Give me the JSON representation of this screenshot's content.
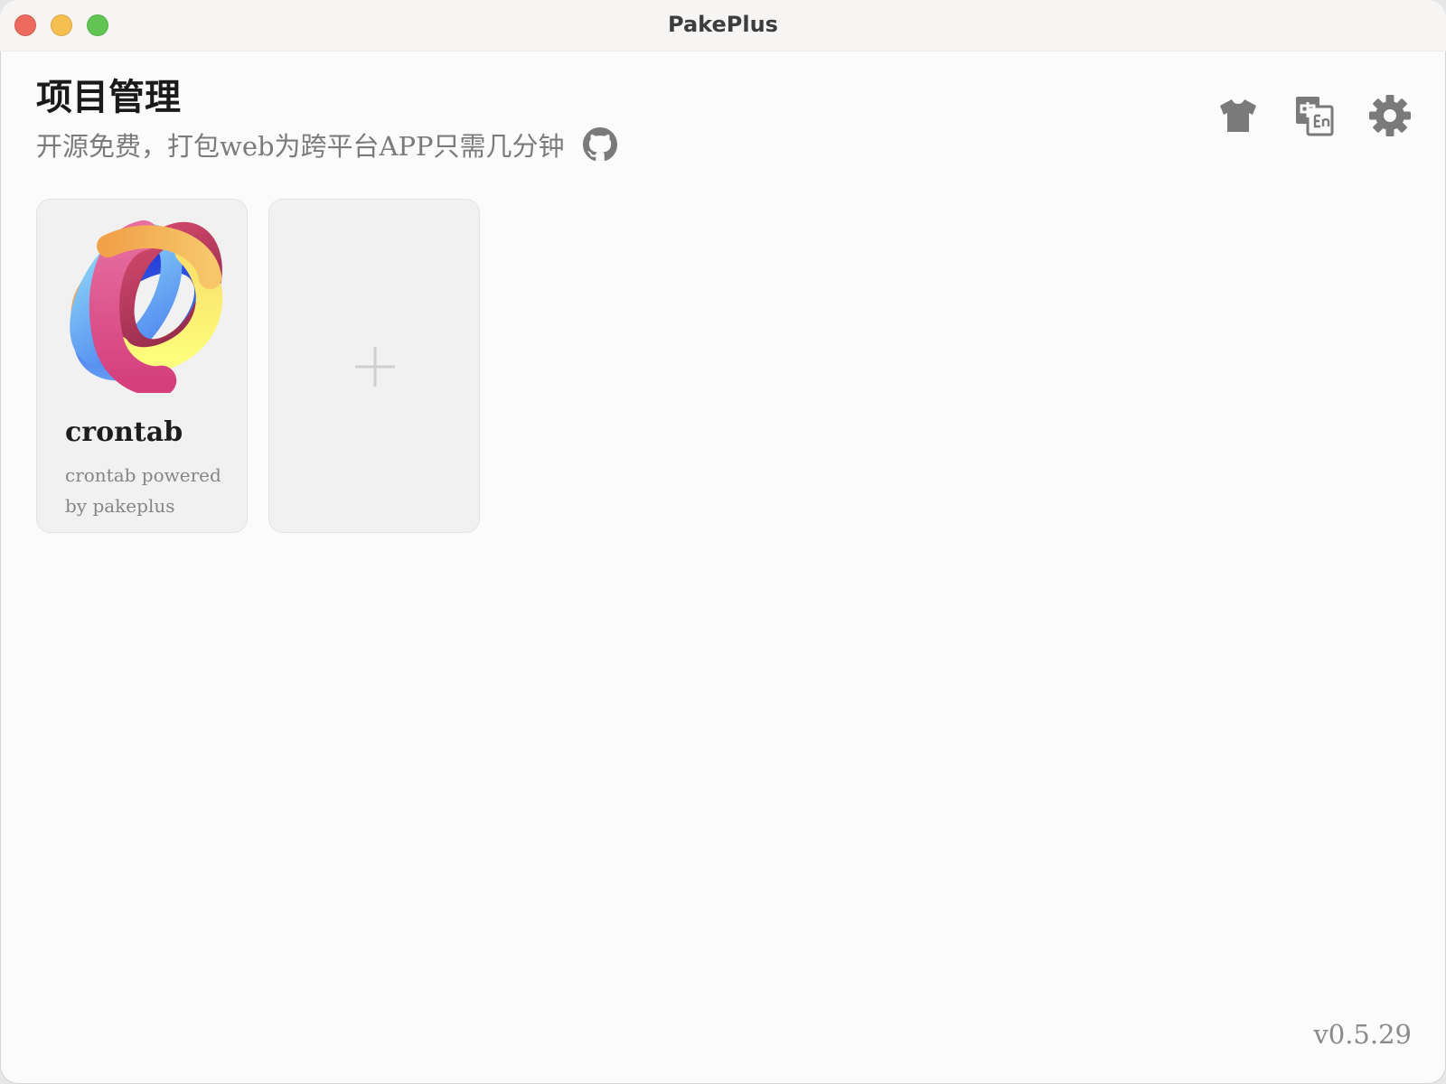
{
  "window": {
    "title": "PakePlus"
  },
  "header": {
    "title": "项目管理",
    "subtitle": "开源免费，打包web为跨平台APP只需几分钟"
  },
  "toolbar": {
    "icons": [
      "tshirt-icon",
      "translate-icon",
      "gear-icon"
    ]
  },
  "projects": [
    {
      "name": "crontab",
      "description": "crontab powered by pakeplus"
    }
  ],
  "footer": {
    "version": "v0.5.29"
  },
  "colors": {
    "icon_gray": "#7a7a7a",
    "title_text": "#1a1a1a",
    "muted_text": "#7b7b7b",
    "card_bg": "#f1f1f1"
  }
}
